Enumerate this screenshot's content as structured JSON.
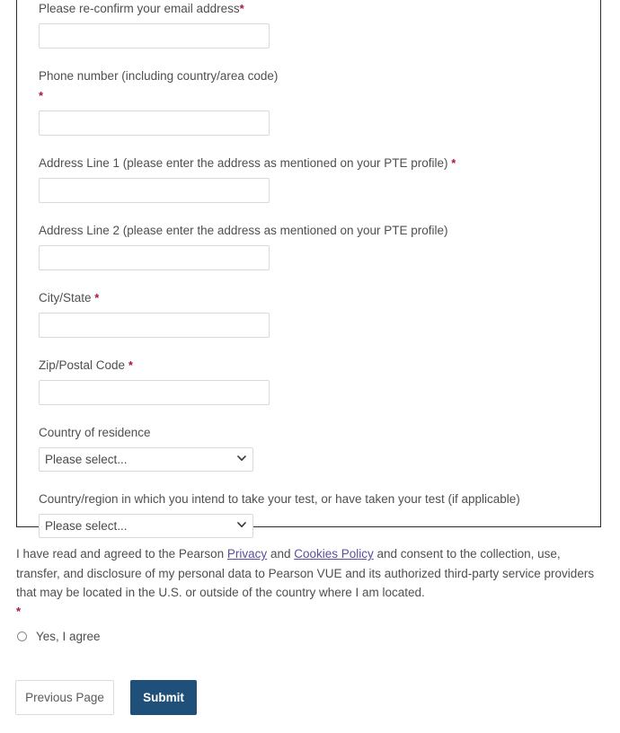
{
  "form": {
    "required_marker": "*",
    "fields": [
      {
        "id": "email-confirm",
        "label": "Please re-confirm your email address",
        "required": true,
        "type": "text",
        "value": "",
        "placeholder": ""
      },
      {
        "id": "phone-number",
        "label": "Phone number (including country/area code)",
        "required": true,
        "required_on_new_line": true,
        "type": "text",
        "value": "",
        "placeholder": ""
      },
      {
        "id": "address-line-1",
        "label": "Address Line 1 (please enter the address as mentioned on your PTE profile)",
        "required": true,
        "type": "text",
        "value": "",
        "placeholder": ""
      },
      {
        "id": "address-line-2",
        "label": "Address Line 2 (please enter the address as mentioned on your PTE profile)",
        "required": false,
        "type": "text",
        "value": "",
        "placeholder": ""
      },
      {
        "id": "city-state",
        "label": "City/State",
        "required": true,
        "type": "text",
        "value": "",
        "placeholder": ""
      },
      {
        "id": "zip-postal-code",
        "label": "Zip/Postal Code",
        "required": true,
        "type": "text",
        "value": "",
        "placeholder": ""
      },
      {
        "id": "country-of-residence",
        "label": "Country of residence",
        "required": false,
        "type": "select",
        "selected": "Please select...",
        "options": [
          "Please select..."
        ]
      },
      {
        "id": "test-country-region",
        "label": "Country/region in which you intend to take your test, or have taken your test (if applicable)",
        "required": false,
        "type": "select",
        "selected": "Please select...",
        "options": [
          "Please select..."
        ]
      }
    ]
  },
  "consent": {
    "text_part_1": "I have read and agreed to the Pearson ",
    "link_privacy": "Privacy",
    "text_part_2": " and ",
    "link_cookies": "Cookies Policy",
    "text_part_3": " and consent to the collection, use, transfer, and disclosure of my personal data to Pearson VUE and its authorized third-party service providers that may be located in the U.S. or outside of the country where I am located.",
    "required_marker": "*",
    "radio_label": "Yes, I agree",
    "radio_checked": false
  },
  "buttons": {
    "previous": "Previous Page",
    "submit": "Submit"
  },
  "colors": {
    "accent_primary": "#1f5079",
    "required_red": "#a8183f",
    "link_purple": "#5b4e9e",
    "input_border": "#d7dadd",
    "panel_border": "#2b2b2b",
    "text": "#4f4f4f"
  }
}
